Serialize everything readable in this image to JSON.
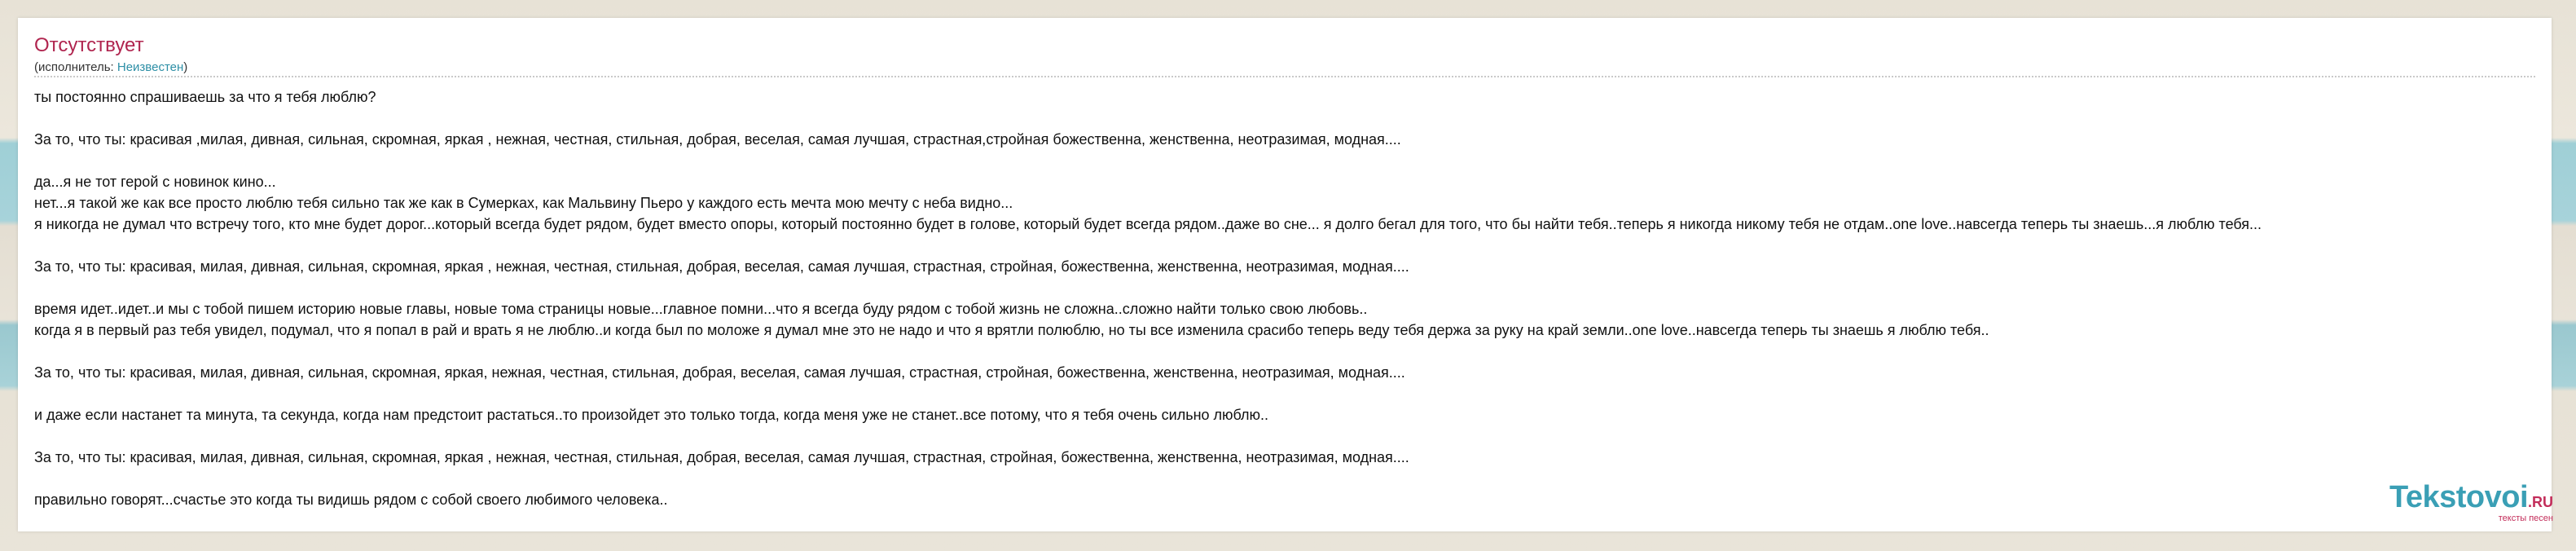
{
  "song": {
    "title": "Отсутствует",
    "artist_prefix": "(исполнитель: ",
    "artist_name": "Неизвестен",
    "artist_suffix": ")"
  },
  "lyrics": [
    "ты постоянно спрашиваешь за что я тебя люблю?",
    "",
    "За то, что ты: красивая ,милая, дивная, сильная, скромная, яркая , нежная, честная, стильная, добрая, веселая, самая лучшая, страстная,стройная божественна, женственна, неотразимая, модная....",
    "",
    "да...я не тот герой с новинок кино...",
    "нет...я такой же как все просто люблю тебя сильно так же как в Сумерках, как Мальвину Пьеро у каждого есть мечта мою мечту с неба видно...",
    "я никогда не думал что встречу того, кто мне будет дорог...который всегда будет рядом, будет вместо опоры, который постоянно будет в голове, который будет всегда рядом..даже во сне... я долго бегал для того, что бы найти тебя..теперь я никогда никому тебя не отдам..one love..навсегда теперь ты знаешь...я люблю тебя...",
    "",
    "За то, что ты: красивая, милая, дивная, сильная, скромная, яркая , нежная, честная, стильная, добрая, веселая, самая лучшая, страстная, стройная, божественна, женственна, неотразимая, модная....",
    "",
    "время идет..идет..и мы с тобой пишем историю новые главы, новые тома страницы новые...главное помни...что я всегда буду рядом с тобой жизнь не сложна..сложно найти только свою любовь..",
    "когда я в первый раз тебя увидел, подумал, что я попал в рай и врать я не люблю..и когда был по моложе я думал мне это не надо и что я врятли полюблю, но ты все изменила срасибо теперь веду тебя держа за руку на край земли..one love..навсегда теперь ты знаешь я люблю тебя..",
    "",
    "За то, что ты: красивая, милая, дивная, сильная, скромная, яркая, нежная, честная, стильная, добрая, веселая, самая лучшая, страстная, стройная, божественна, женственна, неотразимая, модная....",
    "",
    "и даже если настанет та минута, та секунда, когда нам предстоит растаться..то произойдет это только тогда, когда меня уже не станет..все потому, что я тебя очень сильно люблю..",
    "",
    "За то, что ты: красивая, милая, дивная, сильная, скромная, яркая , нежная, честная, стильная, добрая, веселая, самая лучшая, страстная, стройная, божественна, женственна, неотразимая, модная....",
    "",
    "правильно говорят...счастье это когда ты видишь рядом с собой своего любимого человека.."
  ],
  "logo": {
    "name": "Tekstovoi",
    "tld": ".RU",
    "tagline": "тексты песен"
  }
}
